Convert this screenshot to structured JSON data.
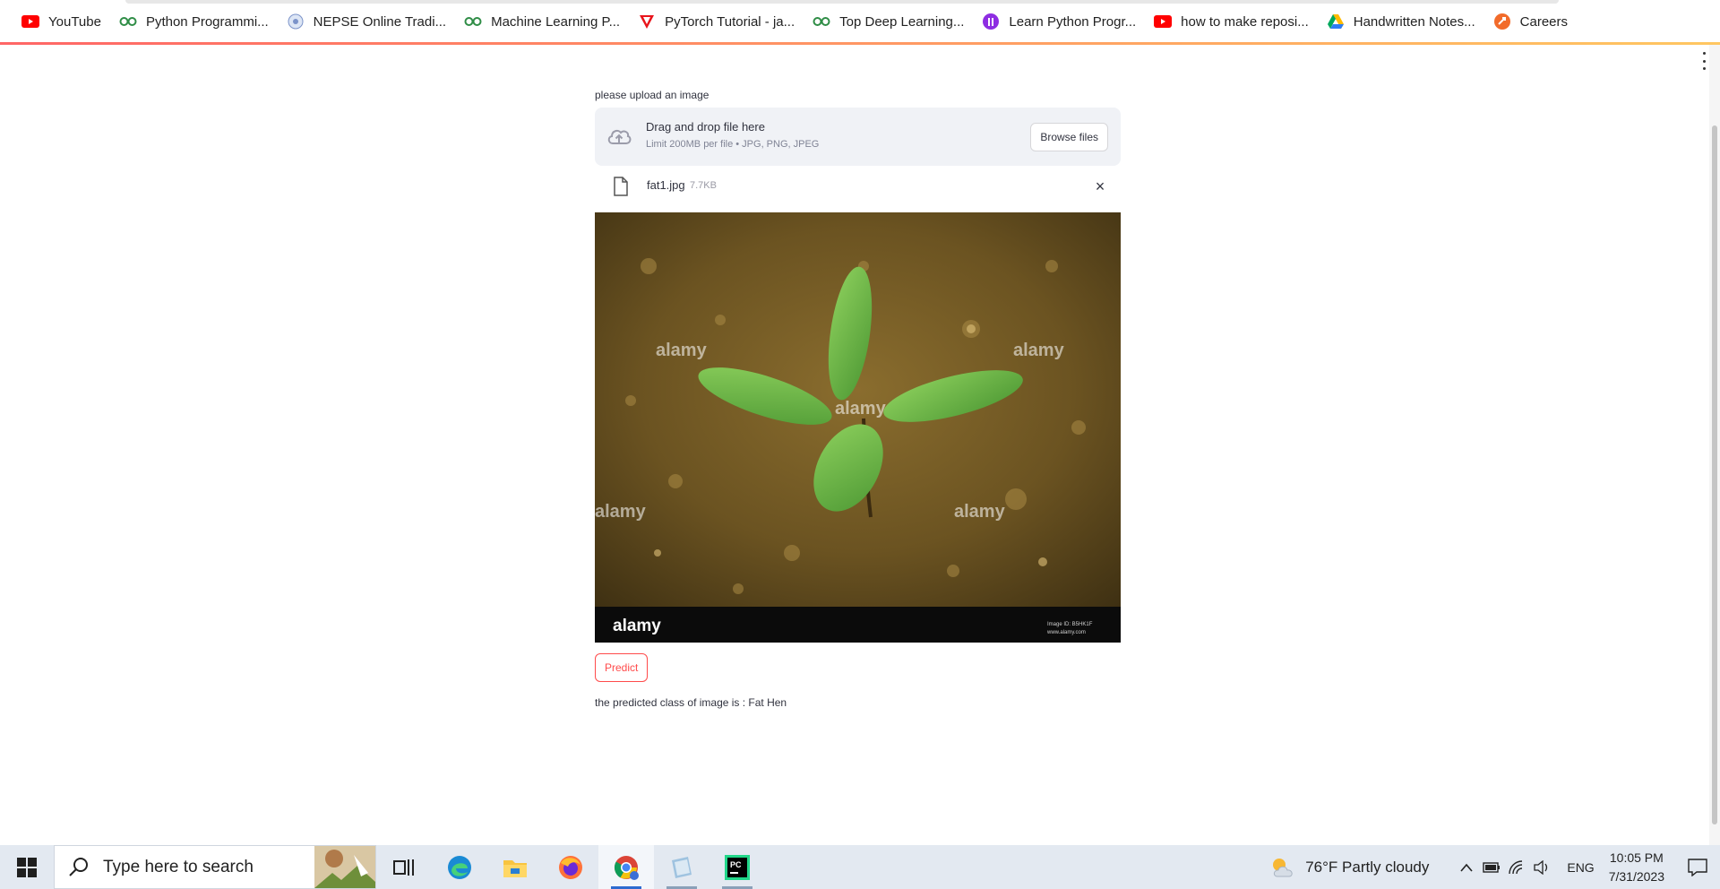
{
  "bookmarks": [
    {
      "label": "YouTube",
      "icon": "youtube-icon"
    },
    {
      "label": "Python Programmi...",
      "icon": "geeksforgeeks-icon"
    },
    {
      "label": "NEPSE Online Tradi...",
      "icon": "nepse-icon"
    },
    {
      "label": "Machine Learning P...",
      "icon": "geeksforgeeks-icon"
    },
    {
      "label": "PyTorch Tutorial - ja...",
      "icon": "javatpoint-icon"
    },
    {
      "label": "Top Deep Learning...",
      "icon": "geeksforgeeks-icon"
    },
    {
      "label": "Learn Python Progr...",
      "icon": "programiz-icon"
    },
    {
      "label": "how to make reposi...",
      "icon": "youtube-icon"
    },
    {
      "label": "Handwritten Notes...",
      "icon": "google-drive-icon"
    },
    {
      "label": "Careers",
      "icon": "careers-icon"
    }
  ],
  "uploader": {
    "label": "please upload an image",
    "drop_title": "Drag and drop file here",
    "drop_subtitle": "Limit 200MB per file • JPG, PNG, JPEG",
    "browse_label": "Browse files"
  },
  "file": {
    "name": "fat1.jpg",
    "size": "7.7KB"
  },
  "image": {
    "watermark": "alamy",
    "footer_text_1": "Image ID: B5HK1F",
    "footer_text_2": "www.alamy.com"
  },
  "predict_label": "Predict",
  "result_text": "the predicted class of image is : Fat Hen",
  "taskbar": {
    "search_placeholder": "Type here to search",
    "weather": "76°F  Partly cloudy",
    "language": "ENG",
    "time": "10:05 PM",
    "date": "7/31/2023"
  },
  "colors": {
    "accent": "#ff4b4b",
    "dropzone_bg": "#f0f2f6",
    "text": "#31333f"
  }
}
